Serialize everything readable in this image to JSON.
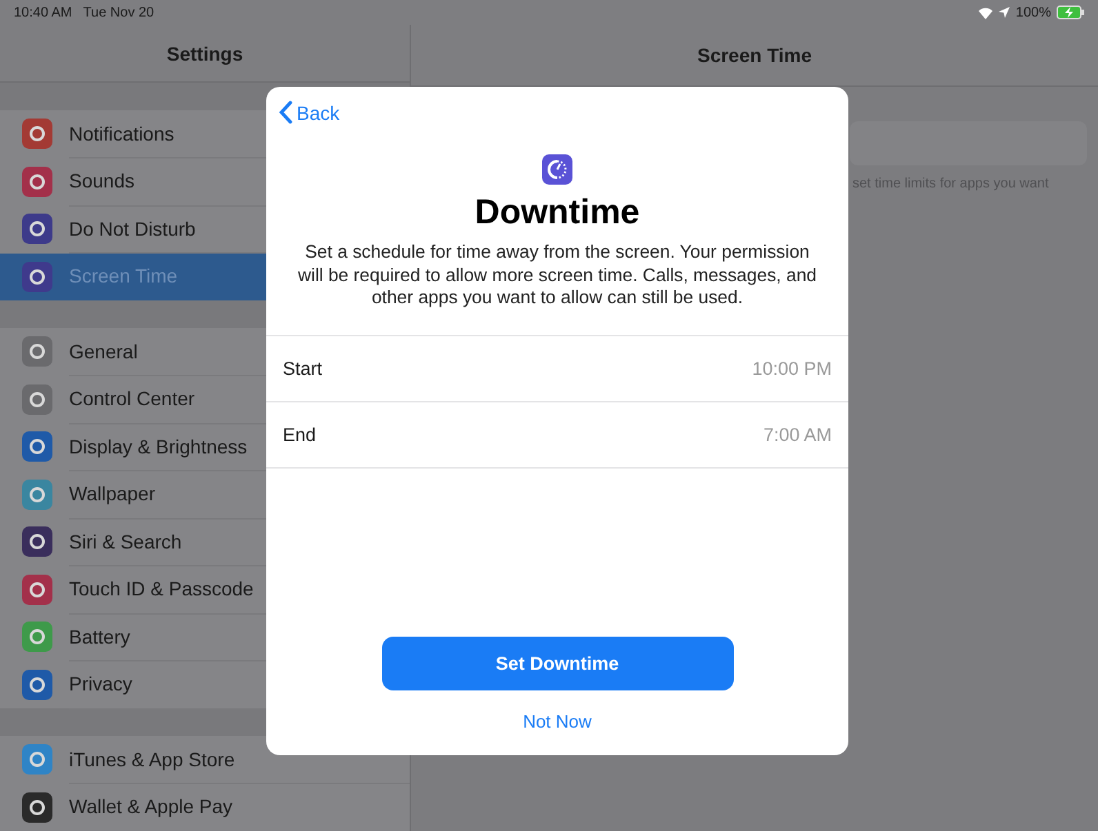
{
  "status_bar": {
    "time": "10:40 AM",
    "date": "Tue Nov 20",
    "battery": "100%"
  },
  "sidebar": {
    "title": "Settings",
    "groups": [
      [
        {
          "label": "Notifications",
          "color": "#a33a34",
          "selected": false
        },
        {
          "label": "Sounds",
          "color": "#a3304a",
          "selected": false
        },
        {
          "label": "Do Not Disturb",
          "color": "#3d3a8a",
          "selected": false
        },
        {
          "label": "Screen Time",
          "color": "#3f3a8c",
          "selected": true
        }
      ],
      [
        {
          "label": "General",
          "color": "#6a6a6d",
          "selected": false
        },
        {
          "label": "Control Center",
          "color": "#6a6a6d",
          "selected": false
        },
        {
          "label": "Display & Brightness",
          "color": "#1f5aa8",
          "selected": false
        },
        {
          "label": "Wallpaper",
          "color": "#3a86a0",
          "selected": false
        },
        {
          "label": "Siri & Search",
          "color": "#3a2e5c",
          "selected": false
        },
        {
          "label": "Touch ID & Passcode",
          "color": "#a3304a",
          "selected": false
        },
        {
          "label": "Battery",
          "color": "#3e9a4a",
          "selected": false
        },
        {
          "label": "Privacy",
          "color": "#1f5aa8",
          "selected": false
        }
      ],
      [
        {
          "label": "iTunes & App Store",
          "color": "#2f84c6",
          "selected": false
        },
        {
          "label": "Wallet & Apple Pay",
          "color": "#2a2a2a",
          "selected": false
        }
      ]
    ]
  },
  "detail": {
    "title": "Screen Time",
    "note": "set time limits for apps you want"
  },
  "modal": {
    "back": "Back",
    "title": "Downtime",
    "description": "Set a schedule for time away from the screen. Your permission will be required to allow more screen time. Calls, messages, and other apps you want to allow can still be used.",
    "rows": [
      {
        "label": "Start",
        "value": "10:00 PM"
      },
      {
        "label": "End",
        "value": "7:00 AM"
      }
    ],
    "primary_button": "Set Downtime",
    "secondary_button": "Not Now"
  }
}
